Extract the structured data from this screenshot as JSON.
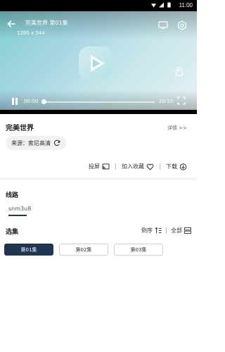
{
  "status_bar": {
    "time": "11:00"
  },
  "player": {
    "title": "完美世界 第01集",
    "resolution": "1280 x 544",
    "current_time": "00:00",
    "total_time": "20:10",
    "progress": 0.0
  },
  "show": {
    "title": "完美世界",
    "detail_link": "详情 >>",
    "source_label": "来源：索尼高清"
  },
  "actions": {
    "cast": "投屏",
    "favorite": "加入收藏",
    "download": "下载"
  },
  "route": {
    "title": "线路",
    "tabs": [
      "snm3u8"
    ]
  },
  "episodes": {
    "title": "选集",
    "sort_label": "倒序",
    "all_label": "全部",
    "items": [
      "第01集",
      "第02集",
      "第03集"
    ]
  },
  "colors": {
    "accent": "#1f3550"
  }
}
